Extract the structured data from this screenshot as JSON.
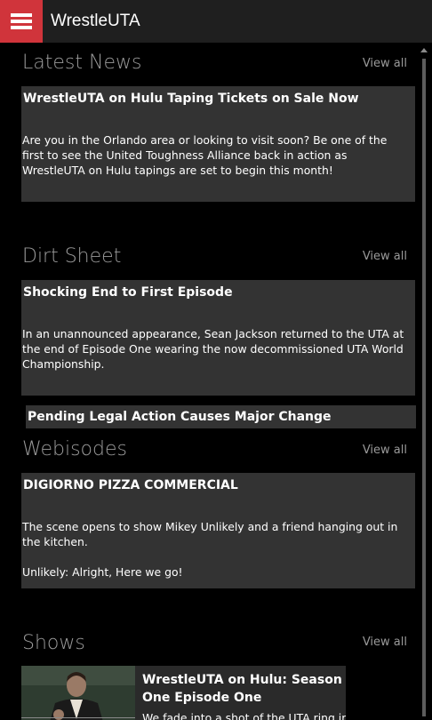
{
  "header": {
    "app_title": "WrestleUTA"
  },
  "sections": {
    "latest_news": {
      "heading": "Latest News",
      "view_all": "View all",
      "card": {
        "title": "WrestleUTA on Hulu Taping Tickets on Sale Now",
        "body": "Are you in the Orlando area or looking to visit soon? Be one of the first to see the United Toughness Alliance back in action as WrestleUTA on Hulu tapings are set to begin this month!"
      }
    },
    "dirt_sheet": {
      "heading": "Dirt Sheet",
      "view_all": "View all",
      "card": {
        "title": "Shocking End to First Episode",
        "body": "In an unannounced appearance, Sean Jackson returned to the UTA at the end of Episode One wearing the now decommissioned UTA World Championship."
      },
      "next_card_title": "Pending Legal Action Causes Major Change"
    },
    "webisodes": {
      "heading": "Webisodes",
      "view_all": "View all",
      "card": {
        "title": "DIGIORNO PIZZA COMMERCIAL",
        "body_lines": [
          "The scene opens to show Mikey Unlikely and a friend hanging out in the kitchen.",
          "Unlikely: Alright, Here we go!"
        ]
      }
    },
    "shows": {
      "heading": "Shows",
      "view_all": "View all",
      "card": {
        "title": "WrestleUTA on Hulu: Season One Episode One",
        "body": "We fade into a shot of the UTA ring in a"
      }
    }
  },
  "colors": {
    "accent": "#d0343b",
    "topbar": "#1f1f1f",
    "card": "#333333",
    "heading": "#9a9a9a"
  },
  "icons": {
    "menu": "hamburger-icon"
  }
}
